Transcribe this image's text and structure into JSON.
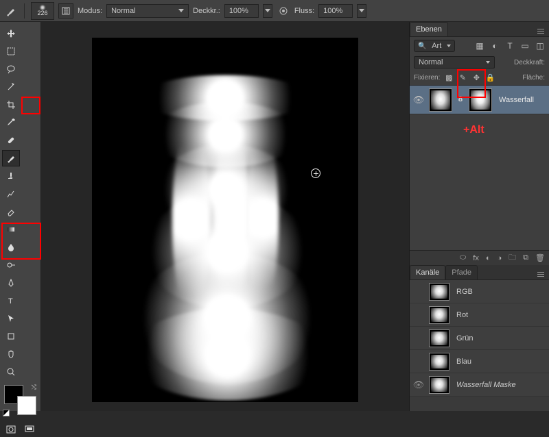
{
  "optbar": {
    "brush_size": "226",
    "mode_label": "Modus:",
    "mode_value": "Normal",
    "opacity_label": "Deckkr.:",
    "opacity_value": "100%",
    "flow_label": "Fluss:",
    "flow_value": "100%"
  },
  "layers_panel": {
    "tab": "Ebenen",
    "filter_label": "Art",
    "blend_mode": "Normal",
    "opacity_label": "Deckkraft:",
    "lock_label": "Fixieren:",
    "fill_label": "Fläche:",
    "layer_name": "Wasserfall",
    "annotation": "+Alt"
  },
  "channels_panel": {
    "tab_channels": "Kanäle",
    "tab_paths": "Pfade",
    "channels": [
      "RGB",
      "Rot",
      "Grün",
      "Blau",
      "Wasserfall Maske"
    ]
  },
  "icons": {
    "link": "⬭",
    "fx": "fx",
    "mask": "◐",
    "adjust": "◑",
    "folder": "🗀",
    "new": "⧉",
    "trash": "🗑"
  }
}
